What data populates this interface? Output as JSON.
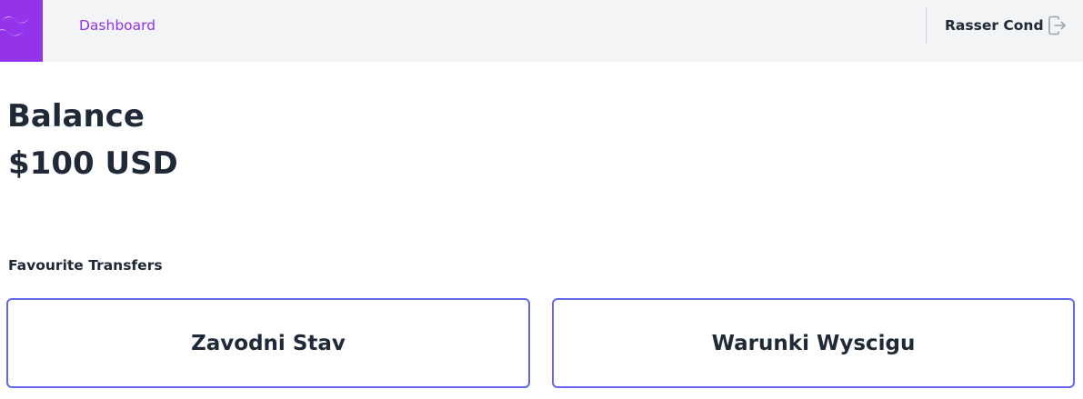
{
  "header": {
    "logo_icon": "wave-logo-icon",
    "nav": {
      "dashboard_label": "Dashboard"
    },
    "user": {
      "name": "Rasser Cond",
      "logout_icon": "logout-icon"
    }
  },
  "balance": {
    "title": "Balance",
    "value": "$100 USD"
  },
  "favourites": {
    "title": "Favourite Transfers",
    "items": [
      {
        "label": "Zavodni Stav"
      },
      {
        "label": "Warunki Wyscigu"
      }
    ]
  },
  "colors": {
    "brand": "#9333ea",
    "card_border": "#6366f1",
    "topbar_bg": "#f3f4f6",
    "text": "#1f2937"
  }
}
